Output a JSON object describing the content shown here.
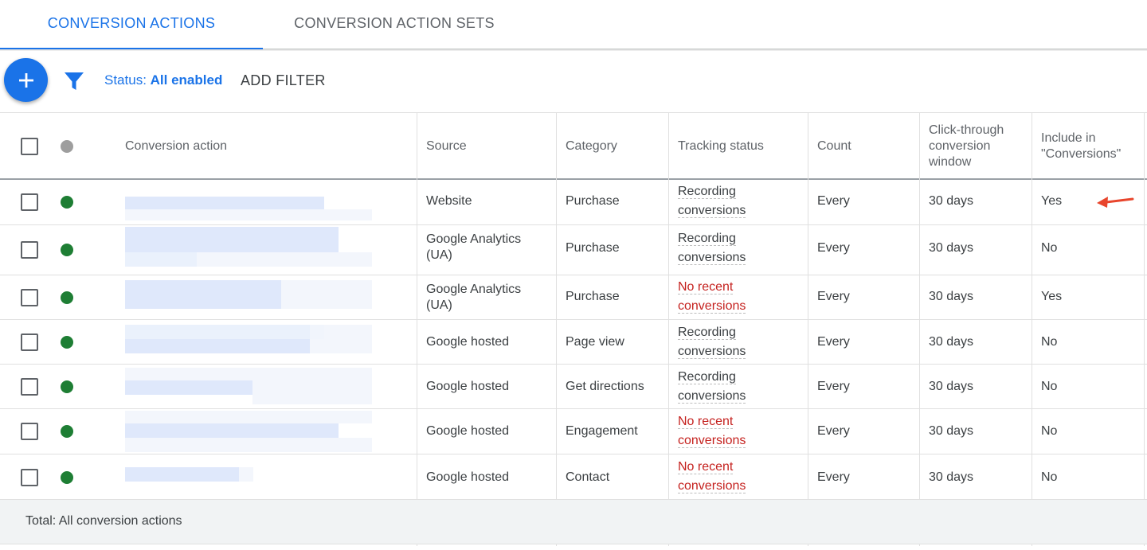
{
  "tabs": [
    {
      "label": "CONVERSION ACTIONS",
      "active": true
    },
    {
      "label": "CONVERSION ACTION SETS",
      "active": false
    }
  ],
  "toolbar": {
    "add_icon": "plus-icon",
    "filter_icon": "filter-funnel-icon",
    "status_label": "Status: ",
    "status_value": "All enabled",
    "add_filter_label": "ADD FILTER"
  },
  "table": {
    "headers": {
      "conversion_action": "Conversion action",
      "source": "Source",
      "category": "Category",
      "tracking_status": "Tracking status",
      "count": "Count",
      "click_through_line1": "Click-through",
      "click_through_line2": "conversion",
      "click_through_line3": "window",
      "include_line1": "Include in",
      "include_line2": "\"Conversions\""
    },
    "rows": [
      {
        "source_1": "Website",
        "source_2": "",
        "category": "Purchase",
        "tracking_1": "Recording",
        "tracking_2": "conversions",
        "tracking_ok": true,
        "count": "Every",
        "window": "30 days",
        "include": "Yes"
      },
      {
        "source_1": "Google Analytics",
        "source_2": "(UA)",
        "category": "Purchase",
        "tracking_1": "Recording",
        "tracking_2": "conversions",
        "tracking_ok": true,
        "count": "Every",
        "window": "30 days",
        "include": "No"
      },
      {
        "source_1": "Google Analytics",
        "source_2": "(UA)",
        "category": "Purchase",
        "tracking_1": "No recent",
        "tracking_2": "conversions",
        "tracking_ok": false,
        "count": "Every",
        "window": "30 days",
        "include": "Yes"
      },
      {
        "source_1": "Google hosted",
        "source_2": "",
        "category": "Page view",
        "tracking_1": "Recording",
        "tracking_2": "conversions",
        "tracking_ok": true,
        "count": "Every",
        "window": "30 days",
        "include": "No"
      },
      {
        "source_1": "Google hosted",
        "source_2": "",
        "category": "Get directions",
        "tracking_1": "Recording",
        "tracking_2": "conversions",
        "tracking_ok": true,
        "count": "Every",
        "window": "30 days",
        "include": "No"
      },
      {
        "source_1": "Google hosted",
        "source_2": "",
        "category": "Engagement",
        "tracking_1": "No recent",
        "tracking_2": "conversions",
        "tracking_ok": false,
        "count": "Every",
        "window": "30 days",
        "include": "No"
      },
      {
        "source_1": "Google hosted",
        "source_2": "",
        "category": "Contact",
        "tracking_1": "No recent",
        "tracking_2": "conversions",
        "tracking_ok": false,
        "count": "Every",
        "window": "30 days",
        "include": "No"
      }
    ],
    "footer_label": "Total: All conversion actions"
  },
  "colors": {
    "accent": "#1a73e8",
    "enabled_dot": "#1e7e34",
    "warning_text": "#c5221f",
    "annotation_arrow": "#e8452c"
  },
  "annotation": {
    "icon": "red-arrow-icon"
  }
}
